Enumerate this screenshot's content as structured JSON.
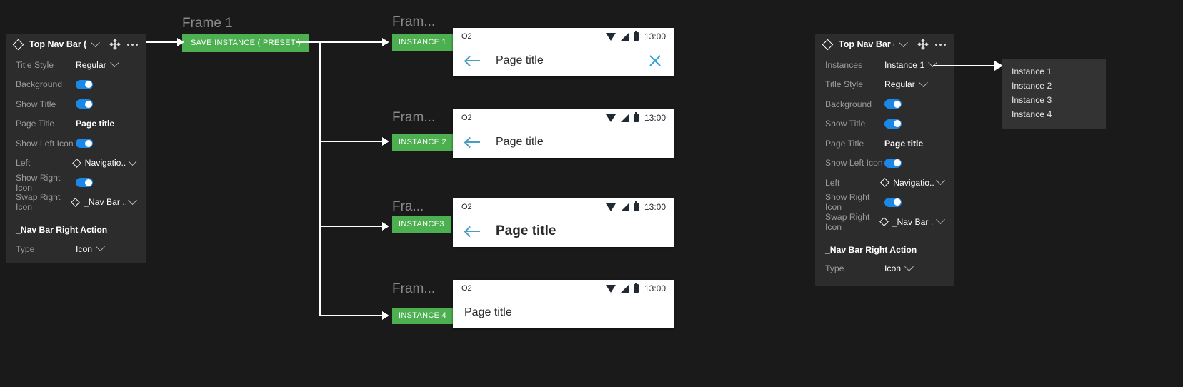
{
  "left_panel": {
    "header": {
      "title": "Top Nav Bar ( An...",
      "icons": [
        "diamond-icon",
        "chevron-down-icon",
        "move-icon",
        "more-options-icon"
      ]
    },
    "rows": [
      {
        "label": "Title Style",
        "type": "select",
        "value": "Regular"
      },
      {
        "label": "Background",
        "type": "toggle",
        "value": "on"
      },
      {
        "label": "Show Title",
        "type": "toggle",
        "value": "on"
      },
      {
        "label": "Page Title",
        "type": "text",
        "value": "Page title"
      },
      {
        "label": "Show Left Icon",
        "type": "toggle",
        "value": "on"
      },
      {
        "label": "Left",
        "type": "instance-select",
        "value": "Navigatio..."
      },
      {
        "label": "Show Right Icon",
        "type": "toggle",
        "value": "on"
      },
      {
        "label": "Swap Right Icon",
        "type": "instance-select",
        "value": "_Nav Bar ..."
      }
    ],
    "section_title": "_Nav Bar Right Action",
    "section_rows": [
      {
        "label": "Type",
        "type": "select",
        "value": "Icon"
      }
    ]
  },
  "right_panel": {
    "header": {
      "title": "Top Nav Bar ( An...",
      "icons": [
        "diamond-icon",
        "chevron-down-icon",
        "move-icon",
        "more-options-icon"
      ]
    },
    "rows": [
      {
        "label": "Instances",
        "type": "select",
        "value": "Instance 1"
      },
      {
        "label": "Title Style",
        "type": "select",
        "value": "Regular"
      },
      {
        "label": "Background",
        "type": "toggle",
        "value": "on"
      },
      {
        "label": "Show Title",
        "type": "toggle",
        "value": "on"
      },
      {
        "label": "Page Title",
        "type": "text",
        "value": "Page title"
      },
      {
        "label": "Show Left Icon",
        "type": "toggle",
        "value": "on"
      },
      {
        "label": "Left",
        "type": "instance-select",
        "value": "Navigatio..."
      },
      {
        "label": "Show Right Icon",
        "type": "toggle",
        "value": "on"
      },
      {
        "label": "Swap Right Icon",
        "type": "instance-select",
        "value": "_Nav Bar ..."
      }
    ],
    "section_title": "_Nav Bar Right Action",
    "section_rows": [
      {
        "label": "Type",
        "type": "select",
        "value": "Icon"
      }
    ]
  },
  "dropdown": {
    "items": [
      "Instance 1",
      "Instance 2",
      "Instance 3",
      "Instance 4"
    ]
  },
  "preset": {
    "frame_label": "Frame 1",
    "chip_label": "SAVE INSTANCE ( PRESET )"
  },
  "instances": [
    {
      "frame_label": "Fram...",
      "chip_label": "INSTANCE 1",
      "status": {
        "carrier": "O2",
        "time": "13:00",
        "icons": [
          "wifi-icon",
          "signal-icon",
          "battery-icon"
        ]
      },
      "nav": {
        "back": true,
        "title": "Page title",
        "title_size": "regular",
        "close": true
      }
    },
    {
      "frame_label": "Fram...",
      "chip_label": "INSTANCE 2",
      "status": {
        "carrier": "O2",
        "time": "13:00",
        "icons": [
          "wifi-icon",
          "signal-icon",
          "battery-icon"
        ]
      },
      "nav": {
        "back": true,
        "title": "Page title",
        "title_size": "regular",
        "close": false
      }
    },
    {
      "frame_label": "Fra...",
      "chip_label": "INSTANCE3",
      "status": {
        "carrier": "O2",
        "time": "13:00",
        "icons": [
          "wifi-icon",
          "signal-icon",
          "battery-icon"
        ]
      },
      "nav": {
        "back": true,
        "title": "Page title",
        "title_size": "large",
        "close": false
      }
    },
    {
      "frame_label": "Fram...",
      "chip_label": "INSTANCE 4",
      "status": {
        "carrier": "O2",
        "time": "13:00",
        "icons": [
          "wifi-icon",
          "signal-icon",
          "battery-icon"
        ]
      },
      "nav": {
        "back": false,
        "title": "Page title",
        "title_size": "regular",
        "close": false
      }
    }
  ],
  "colors": {
    "canvas_bg": "#1a1a1a",
    "panel_bg": "#2c2c2c",
    "accent_green": "#4caf50",
    "toggle_blue": "#1b87e6",
    "icon_teal": "#4a9fc0",
    "dropdown_bg": "#333333"
  }
}
